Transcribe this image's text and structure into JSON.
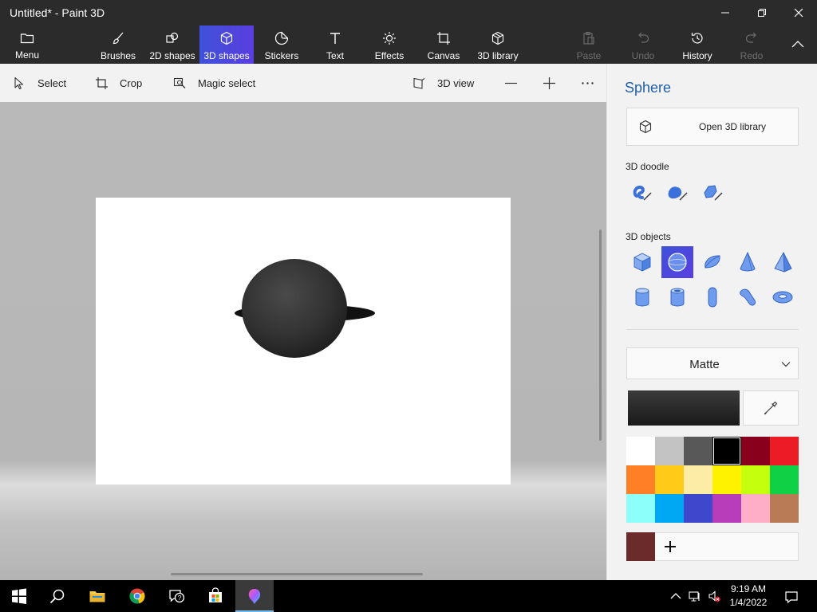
{
  "window": {
    "title": "Untitled* - Paint 3D",
    "minimize_icon": "minimize-icon",
    "maximize_icon": "restore-icon",
    "close_icon": "close-icon"
  },
  "ribbon": {
    "menu_label": "Menu",
    "tools": [
      {
        "label": "Brushes",
        "icon": "brush-icon"
      },
      {
        "label": "2D shapes",
        "icon": "2d-shapes-icon"
      },
      {
        "label": "3D shapes",
        "icon": "3d-cube-icon",
        "active": true
      },
      {
        "label": "Stickers",
        "icon": "sticker-icon"
      },
      {
        "label": "Text",
        "icon": "text-icon"
      },
      {
        "label": "Effects",
        "icon": "sun-icon"
      },
      {
        "label": "Canvas",
        "icon": "canvas-icon"
      },
      {
        "label": "3D library",
        "icon": "3d-library-icon"
      }
    ],
    "right_tools": [
      {
        "label": "Paste",
        "icon": "paste-icon",
        "disabled": true
      },
      {
        "label": "Undo",
        "icon": "undo-icon",
        "disabled": true
      },
      {
        "label": "History",
        "icon": "history-icon",
        "disabled": false
      },
      {
        "label": "Redo",
        "icon": "redo-icon",
        "disabled": true
      }
    ],
    "collapse_icon": "chevron-up-icon",
    "active_color": "#4a4ae0"
  },
  "command_bar": {
    "select": "Select",
    "crop": "Crop",
    "magic_select": "Magic select",
    "view_3d": "3D view"
  },
  "panel": {
    "title": "Sphere",
    "open_library": "Open 3D library",
    "doodle_label": "3D doodle",
    "objects_label": "3D objects",
    "doodle_tools": [
      "sharp-edge-doodle-icon",
      "soft-edge-doodle-icon",
      "tube-doodle-icon"
    ],
    "objects": [
      "cube-icon",
      "sphere-icon",
      "hemisphere-icon",
      "cone-icon",
      "pyramid-icon",
      "cylinder-icon",
      "tube-icon",
      "capsule-icon",
      "bent-tube-icon",
      "torus-icon"
    ],
    "selected_object": "sphere-icon",
    "material": "Matte",
    "current_color": "#222222",
    "palette": [
      "#ffffff",
      "#c3c3c3",
      "#585858",
      "#000000",
      "#88001b",
      "#ec1c24",
      "#ff7f27",
      "#ffca18",
      "#fdeca6",
      "#fff200",
      "#c4ff0e",
      "#0ed145",
      "#8cfffb",
      "#00a8f3",
      "#3f48cc",
      "#b83dba",
      "#ffaec8",
      "#b97a56"
    ],
    "selected_swatch_index": 3,
    "custom_color": "#6b2b2b"
  },
  "taskbar": {
    "apps": [
      "windows-start-icon",
      "search-icon",
      "file-explorer-icon",
      "chrome-icon",
      "get-help-icon",
      "microsoft-store-icon",
      "paint-3d-icon"
    ],
    "active_app": "paint-3d-icon",
    "time": "9:19 AM",
    "date": "1/4/2022"
  }
}
